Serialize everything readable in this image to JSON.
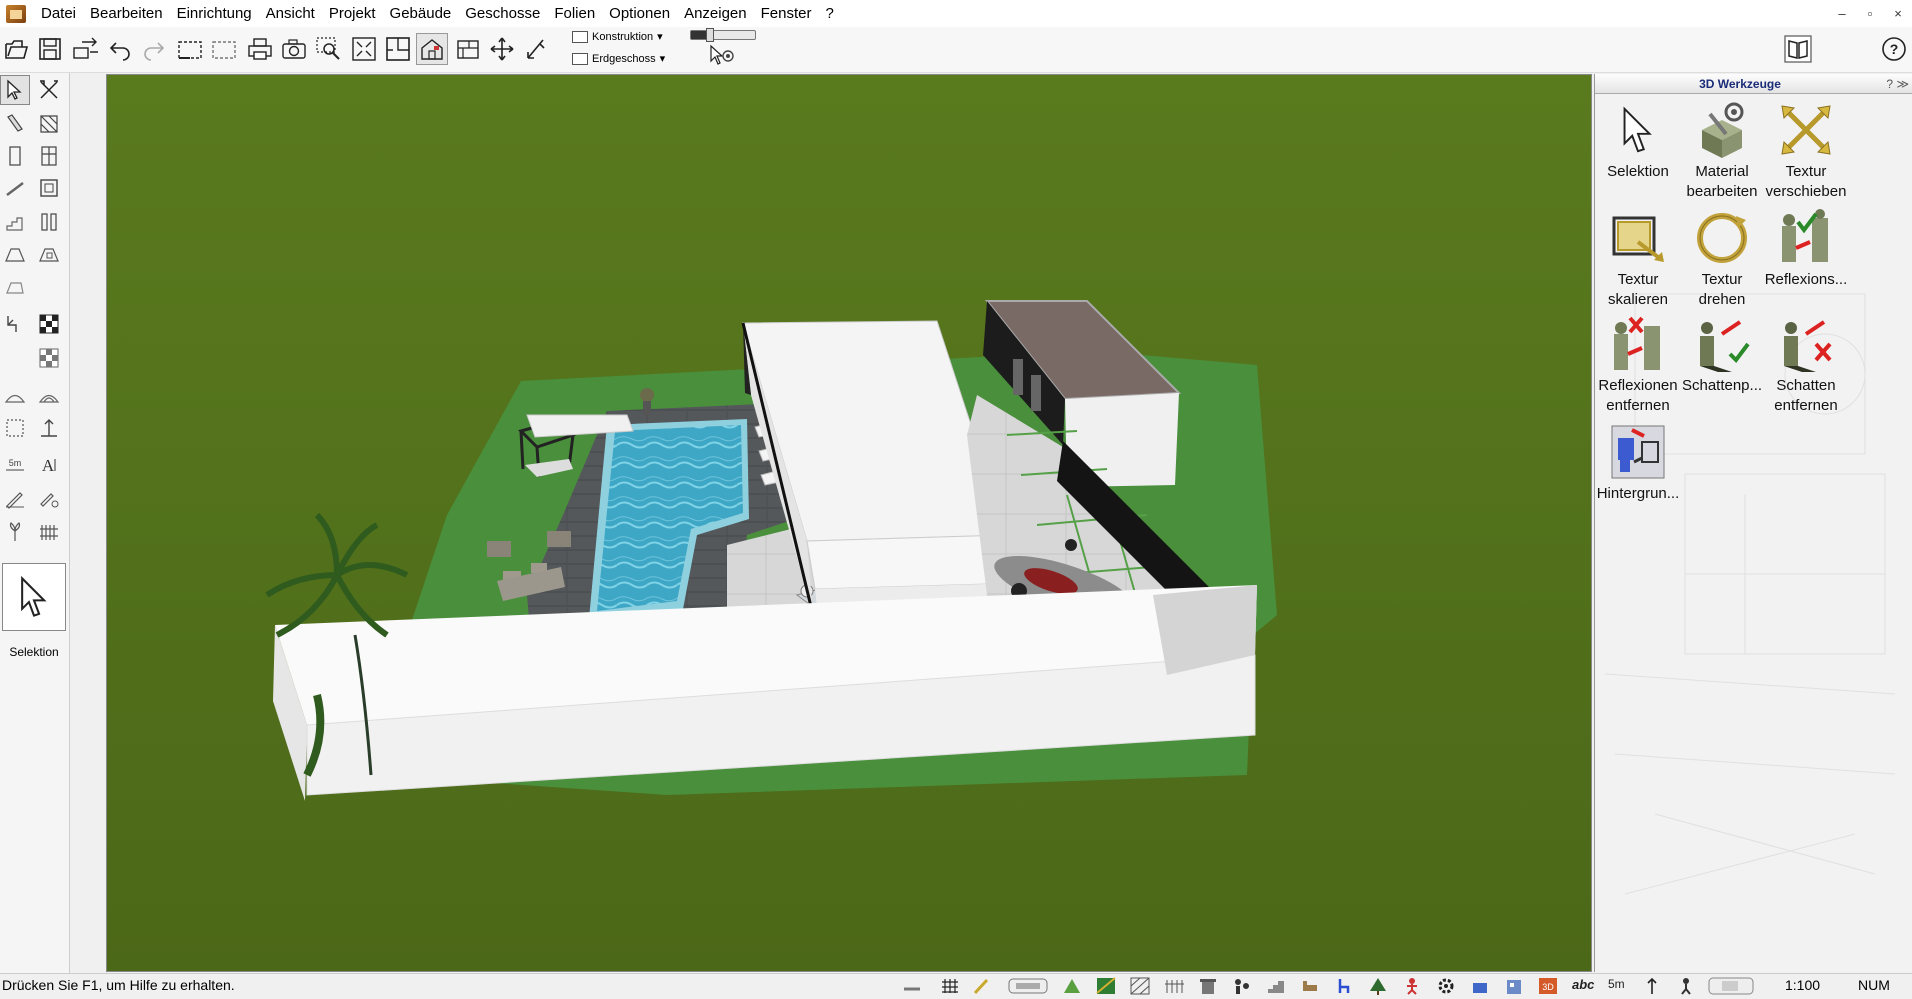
{
  "menu": [
    "Datei",
    "Bearbeiten",
    "Einrichtung",
    "Ansicht",
    "Projekt",
    "Gebäude",
    "Geschosse",
    "Folien",
    "Optionen",
    "Anzeigen",
    "Fenster",
    "?"
  ],
  "window_controls": [
    "–",
    "▫",
    "×"
  ],
  "toolbar": {
    "layer_dropdown": "Konstruktion",
    "floor_dropdown": "Erdgeschoss",
    "slider_level": 0.3,
    "buttons": [
      "open-icon",
      "save-icon",
      "transfer-icon",
      "undo-icon",
      "redo-icon",
      "select-area-icon",
      "select-area2-icon",
      "print-icon",
      "camera-icon",
      "zoom-window-icon",
      "zoom-fit-icon",
      "floorplan-icon",
      "3d-view-icon",
      "elevation-icon",
      "pan-icon",
      "measure-icon"
    ]
  },
  "left_tools": {
    "selection_label": "Selektion"
  },
  "panel": {
    "title": "3D Werkzeuge",
    "help": "?",
    "chevron": "≫",
    "tools": [
      {
        "label": "Selektion",
        "icon": "cursor-icon"
      },
      {
        "label": "Material\nbearbeiten",
        "icon": "material-edit-icon"
      },
      {
        "label": "Textur\nverschieben",
        "icon": "texture-move-icon"
      },
      {
        "label": "Textur\nskalieren",
        "icon": "texture-scale-icon"
      },
      {
        "label": "Textur\ndrehen",
        "icon": "texture-rotate-icon"
      },
      {
        "label": "Reflexions...",
        "icon": "reflection-icon"
      },
      {
        "label": "Reflexionen\nentfernen",
        "icon": "reflection-remove-icon"
      },
      {
        "label": "Schattenp...",
        "icon": "shadow-icon"
      },
      {
        "label": "Schatten\nentfernen",
        "icon": "shadow-remove-icon"
      },
      {
        "label": "Hintergrun...",
        "icon": "background-icon"
      }
    ]
  },
  "status": {
    "help_text": "Drücken Sie F1, um Hilfe zu erhalten.",
    "scale": "1:100",
    "num": "NUM",
    "abc": "abc",
    "dim": "5m"
  },
  "colors": {
    "ground": "#5c7a1f",
    "lawn": "#4d8a3a",
    "pool": "#3aa9c8",
    "deck": "#555a5c",
    "wall": "#f2f2f2",
    "panel_title": "#1a2b78"
  }
}
